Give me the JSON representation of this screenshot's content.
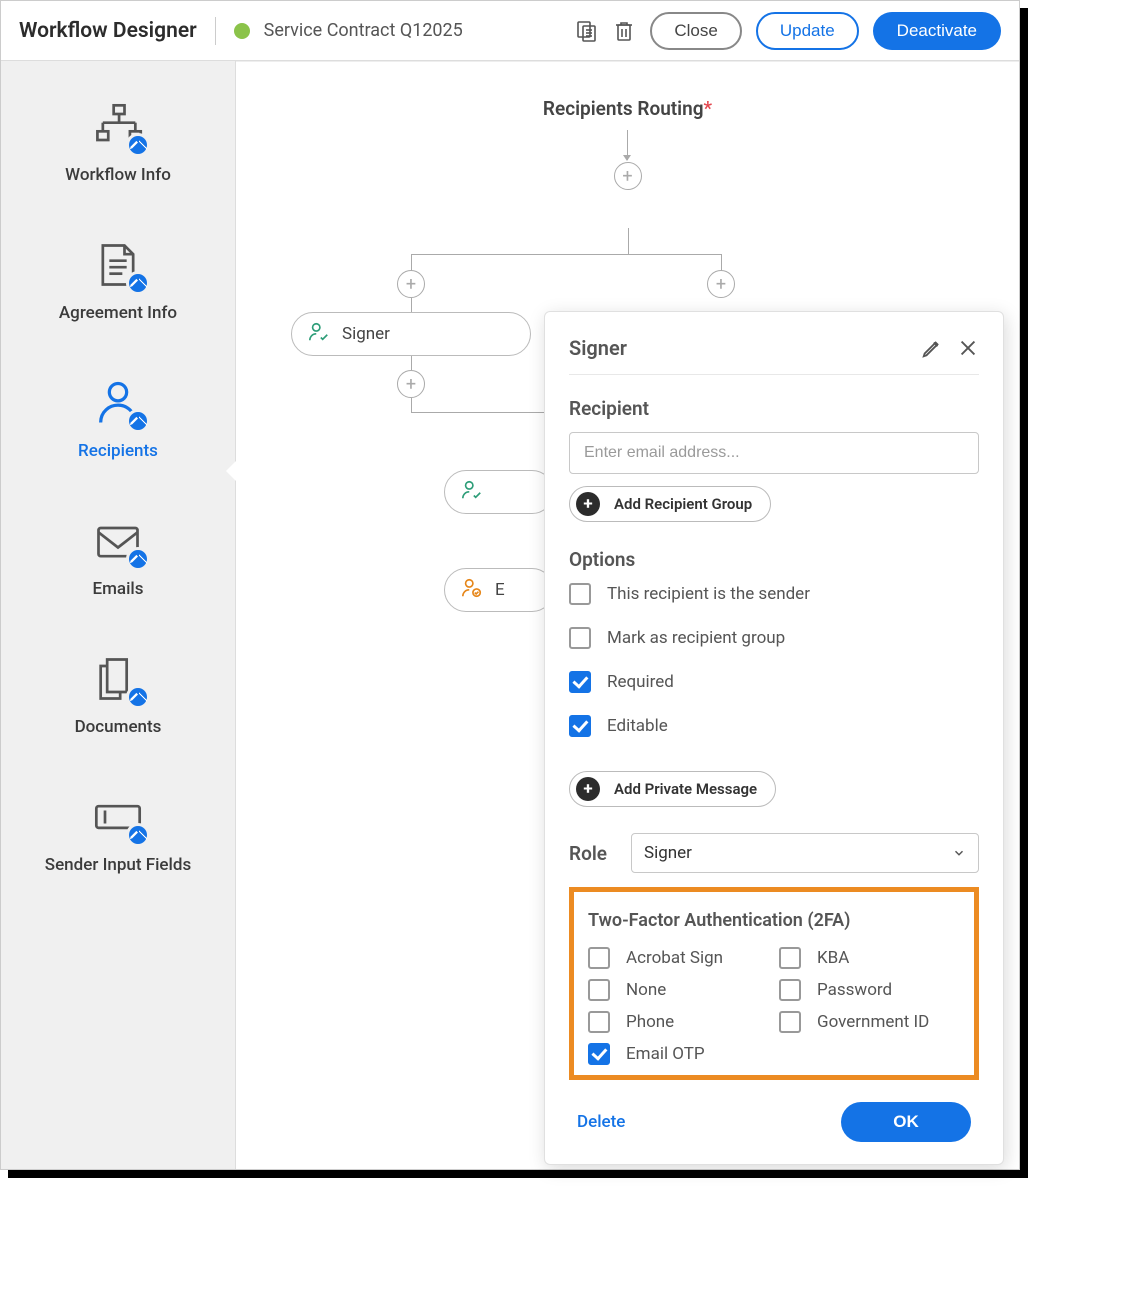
{
  "header": {
    "app_title": "Workflow Designer",
    "doc_title": "Service Contract Q12025",
    "close": "Close",
    "update": "Update",
    "deactivate": "Deactivate"
  },
  "sidebar": {
    "items": [
      {
        "label": "Workflow Info"
      },
      {
        "label": "Agreement Info"
      },
      {
        "label": "Recipients"
      },
      {
        "label": "Emails"
      },
      {
        "label": "Documents"
      },
      {
        "label": "Sender Input Fields"
      }
    ]
  },
  "canvas": {
    "section_title": "Recipients Routing",
    "required_mark": "*",
    "nodes": {
      "signer1": "Signer",
      "expand": "E"
    }
  },
  "popup": {
    "title": "Signer",
    "recipient_label": "Recipient",
    "email_placeholder": "Enter email address...",
    "add_group": "Add Recipient Group",
    "options_label": "Options",
    "opts": {
      "is_sender": "This recipient is the sender",
      "mark_group": "Mark as recipient group",
      "required": "Required",
      "editable": "Editable"
    },
    "add_private": "Add Private Message",
    "role_label": "Role",
    "role_value": "Signer",
    "tfa_title": "Two-Factor Authentication (2FA)",
    "tfa": {
      "acrobat": "Acrobat Sign",
      "none": "None",
      "phone": "Phone",
      "emailotp": "Email OTP",
      "kba": "KBA",
      "password": "Password",
      "govid": "Government ID"
    },
    "delete": "Delete",
    "ok": "OK"
  }
}
